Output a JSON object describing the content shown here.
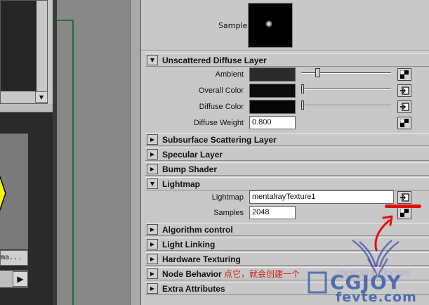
{
  "left_panel": {
    "thumbnail_label": "ma...",
    "play_glyph": "▶",
    "scroll_glyph": "▼"
  },
  "sample": {
    "label": "Sample"
  },
  "frames": {
    "unscattered": {
      "title": "Unscattered Diffuse Layer",
      "expanded": true,
      "attrs": {
        "ambient": {
          "label": "Ambient",
          "color": "#2b2b2b",
          "slider": 0.18
        },
        "overall_color": {
          "label": "Overall Color",
          "color": "#0c0c0c",
          "slider": 0.0
        },
        "diffuse_color": {
          "label": "Diffuse Color",
          "color": "#070707",
          "slider": 0.0
        },
        "diffuse_weight": {
          "label": "Diffuse Weight",
          "value": "0.800"
        }
      }
    },
    "subsurface": {
      "title": "Subsurface Scattering Layer",
      "expanded": false
    },
    "specular": {
      "title": "Specular Layer",
      "expanded": false
    },
    "bump": {
      "title": "Bump Shader",
      "expanded": false
    },
    "lightmap": {
      "title": "Lightmap",
      "expanded": true,
      "attrs": {
        "lightmap": {
          "label": "Lightmap",
          "value": "mentalrayTexture1"
        },
        "samples": {
          "label": "Samples",
          "value": "2048"
        }
      }
    },
    "algorithm": {
      "title": "Algorithm control",
      "expanded": false
    },
    "light_linking": {
      "title": "Light Linking",
      "expanded": false
    },
    "hardware": {
      "title": "Hardware Texturing",
      "expanded": false
    },
    "node_behavior": {
      "title": "Node Behavior",
      "expanded": false
    },
    "extra": {
      "title": "Extra Attributes",
      "expanded": false
    }
  },
  "glyphs": {
    "expanded": "▼",
    "collapsed": "▶"
  },
  "annotation": {
    "text": "点它，就会创建一个",
    "tail": "mentalrayTexture",
    "color": "#d21818"
  },
  "watermark": {
    "brand": "CGJOY",
    "url": "fevte.com"
  },
  "colors": {
    "panel": "#c8c8c8",
    "viewport_dark": "#2a2a2a",
    "green_line": "#1f6f3a",
    "yellow": "#f4f40a"
  }
}
